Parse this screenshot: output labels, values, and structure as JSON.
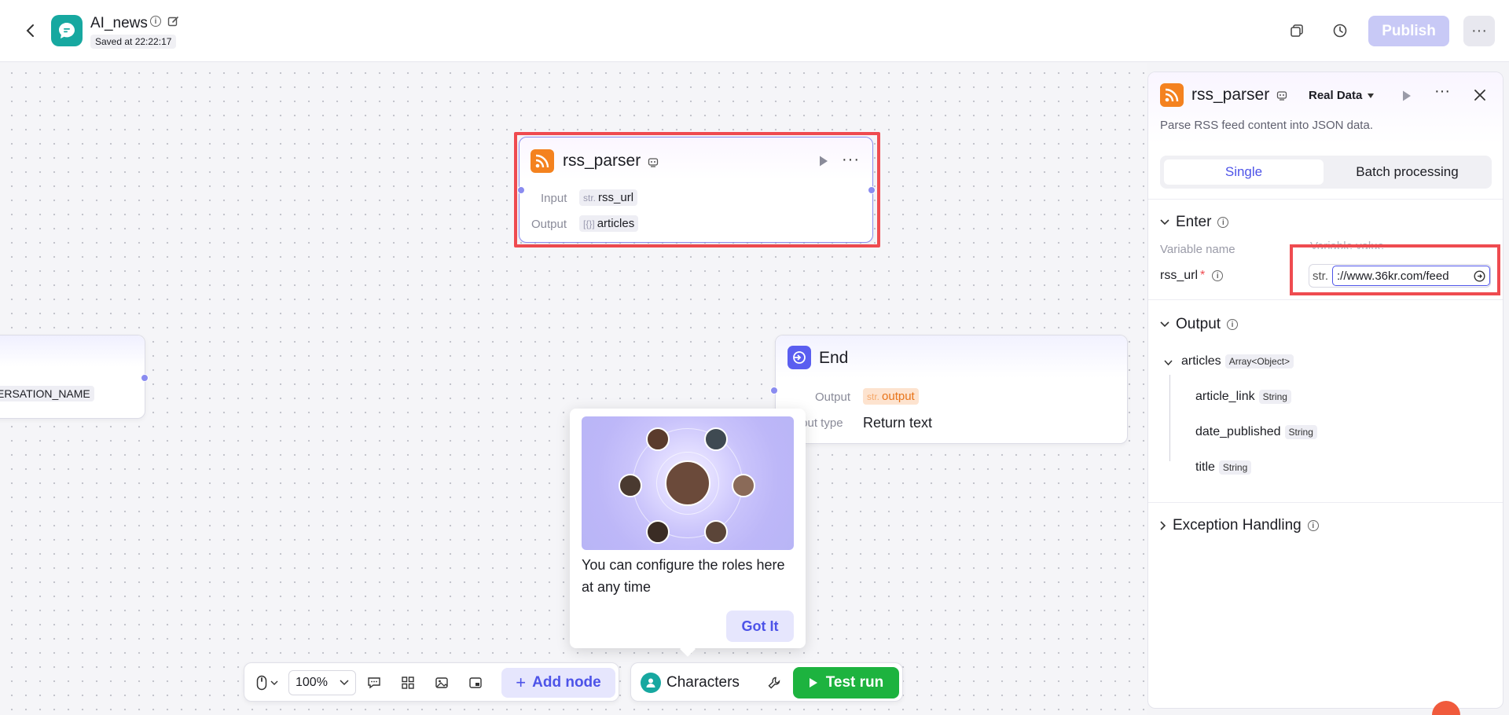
{
  "header": {
    "app_title": "AI_news",
    "saved_status": "Saved at 22:22:17",
    "publish_label": "Publish",
    "more_label": "···"
  },
  "canvas": {
    "rss_node": {
      "title": "rss_parser",
      "input_label": "Input",
      "input_type": "str.",
      "input_value": "rss_url",
      "output_label": "Output",
      "output_type": "[{}]",
      "output_value": "articles"
    },
    "left_node": {
      "variable": "ERSATION_NAME"
    },
    "end_node": {
      "title": "End",
      "output_label": "Output",
      "output_type": "str.",
      "output_value": "output",
      "output_type_label": "tput type",
      "output_type_value": "Return text"
    }
  },
  "popover": {
    "text": "You can configure the roles here at any time",
    "button": "Got It"
  },
  "toolbar": {
    "zoom": "100%",
    "add_node": "Add node",
    "characters": "Characters",
    "test_run": "Test run"
  },
  "panel": {
    "title": "rss_parser",
    "data_mode": "Real Data",
    "description": "Parse RSS feed content into JSON data.",
    "tab_single": "Single",
    "tab_batch": "Batch processing",
    "enter_title": "Enter",
    "col_name": "Variable name",
    "col_value": "Variable value",
    "var_name": "rss_url",
    "var_required": "*",
    "var_type": "str.",
    "var_value": "://www.36kr.com/feed",
    "output_title": "Output",
    "outputs": [
      {
        "name": "articles",
        "type": "Array<Object>"
      },
      {
        "name": "article_link",
        "type": "String"
      },
      {
        "name": "date_published",
        "type": "String"
      },
      {
        "name": "title",
        "type": "String"
      }
    ],
    "exception_title": "Exception Handling"
  },
  "colors": {
    "accent": "#4d53e8",
    "highlight": "#ef4b50",
    "run_green": "#1db33f",
    "rss_orange": "#f4821f",
    "app_teal": "#17a8a0"
  }
}
